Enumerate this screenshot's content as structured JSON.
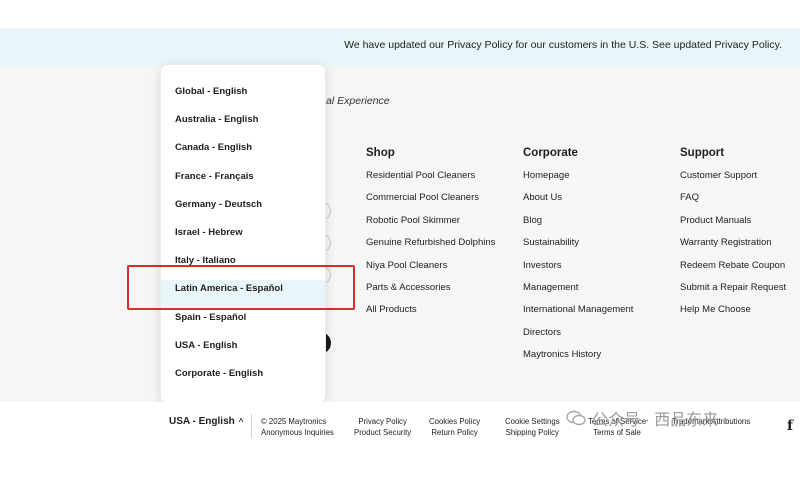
{
  "privacy_bar": {
    "text": "We have updated our Privacy Policy for our customers in the U.S. See updated Privacy Policy."
  },
  "tagline_partial": "ional Experience",
  "columns": [
    {
      "title": "Shop",
      "links": [
        "Residential Pool Cleaners",
        "Commercial Pool Cleaners",
        "Robotic Pool Skimmer",
        "Genuine Refurbished Dolphins",
        "Niya Pool Cleaners",
        "Parts & Accessories",
        "All Products"
      ]
    },
    {
      "title": "Corporate",
      "links": [
        "Homepage",
        "About Us",
        "Blog",
        "Sustainability",
        "Investors",
        "Management",
        "International Management",
        "Directors",
        "Maytronics History"
      ]
    },
    {
      "title": "Support",
      "links": [
        "Customer Support",
        "FAQ",
        "Product Manuals",
        "Warranty Registration",
        "Redeem Rebate Coupon",
        "Submit a Repair Request",
        "Help Me Choose"
      ]
    }
  ],
  "language_dropdown": {
    "options": [
      "Global - English",
      "Australia - English",
      "Canada - English",
      "France - Français",
      "Germany - Deutsch",
      "Israel - Hebrew",
      "Italy - Italiano",
      "Latin America - Español",
      "Spain - Español",
      "USA - English",
      "Corporate - English"
    ],
    "highlighted": "Latin America - Español"
  },
  "footer_bottom": {
    "current_language": "USA - English",
    "chevron_icon": "chevron-up-icon",
    "legal_columns": [
      [
        "© 2025 Maytronics",
        "Anonymous Inquiries"
      ],
      [
        "Privacy Policy",
        "Product Security"
      ],
      [
        "Cookies Policy",
        "Return Policy"
      ],
      [
        "Cookie Settings",
        "Shipping Policy"
      ],
      [
        "Terms of Service",
        "Terms of Sale"
      ],
      [
        "Trademark Attributions"
      ]
    ],
    "social_icon": "facebook-icon",
    "social_glyph": "f"
  },
  "watermark": {
    "text": "公众号 · 西品东来"
  },
  "colors": {
    "privacy_bar_bg": "#e9f6f9",
    "footer_bg": "#f5f6f6",
    "highlight_border": "#e0282e",
    "text": "#1e1e1e"
  }
}
